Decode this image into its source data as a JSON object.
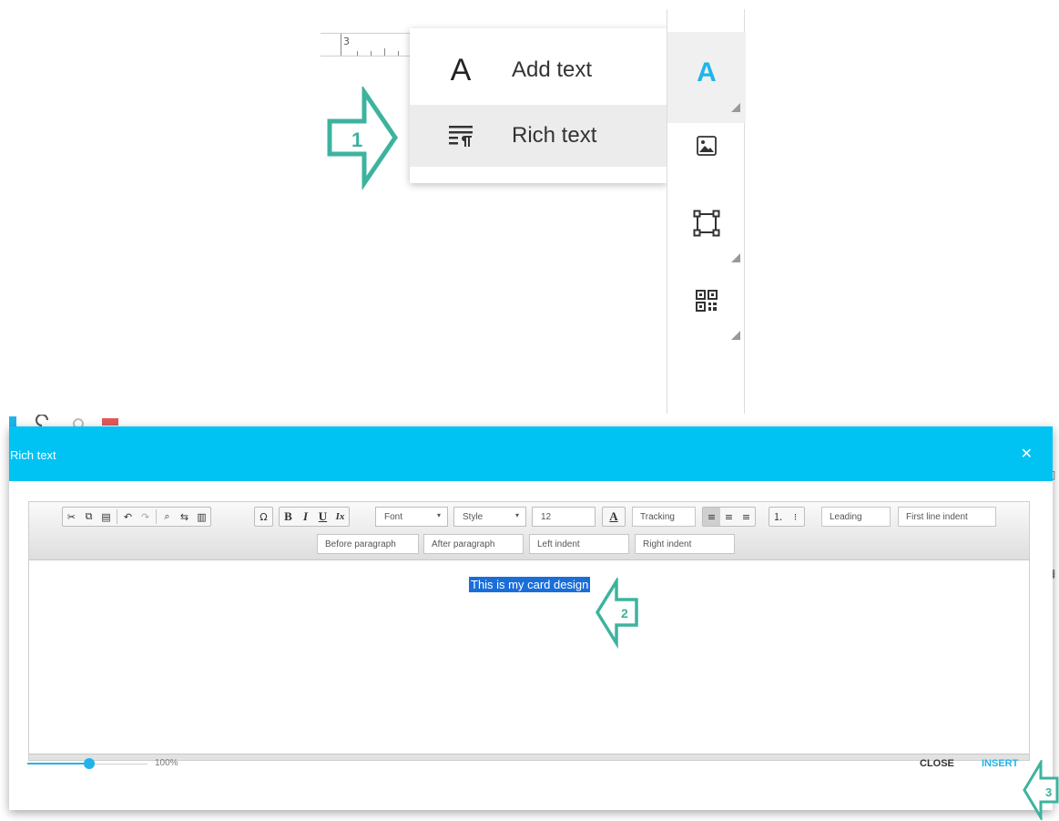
{
  "ruler": {
    "label": "3"
  },
  "dropdown": {
    "items": [
      {
        "label": "Add text",
        "icon": "letter-a-icon",
        "glyph": "A"
      },
      {
        "label": "Rich text",
        "icon": "rich-text-icon"
      }
    ]
  },
  "toolrail": {
    "items": [
      {
        "icon": "text-tool-icon",
        "glyph": "A",
        "active": true
      },
      {
        "icon": "image-icon"
      },
      {
        "icon": "shape-icon"
      },
      {
        "icon": "qr-code-icon"
      }
    ],
    "accent": "#1fb5ea"
  },
  "callouts": {
    "one": "1",
    "two": "2",
    "three": "3",
    "color": "#3db39e"
  },
  "modal": {
    "title": "Rich text",
    "close_glyph": "✕",
    "header_color": "#00c2f3",
    "toolbar": {
      "font_label": "Font",
      "style_label": "Style",
      "size_value": "12",
      "tracking_placeholder": "Tracking",
      "leading_placeholder": "Leading",
      "first_line_indent_placeholder": "First line indent",
      "before_paragraph_placeholder": "Before paragraph",
      "after_paragraph_placeholder": "After paragraph",
      "left_indent_placeholder": "Left indent",
      "right_indent_placeholder": "Right indent",
      "bold": "B",
      "italic": "I",
      "underline": "U",
      "clear_format": "Ix",
      "special_char": "Ω",
      "font_color": "A"
    },
    "content": {
      "selected_text": "This is my card design"
    },
    "zoom": {
      "label": "100%",
      "level_fraction": 0.5
    },
    "buttons": {
      "close": "CLOSE",
      "insert": "INSERT"
    }
  }
}
